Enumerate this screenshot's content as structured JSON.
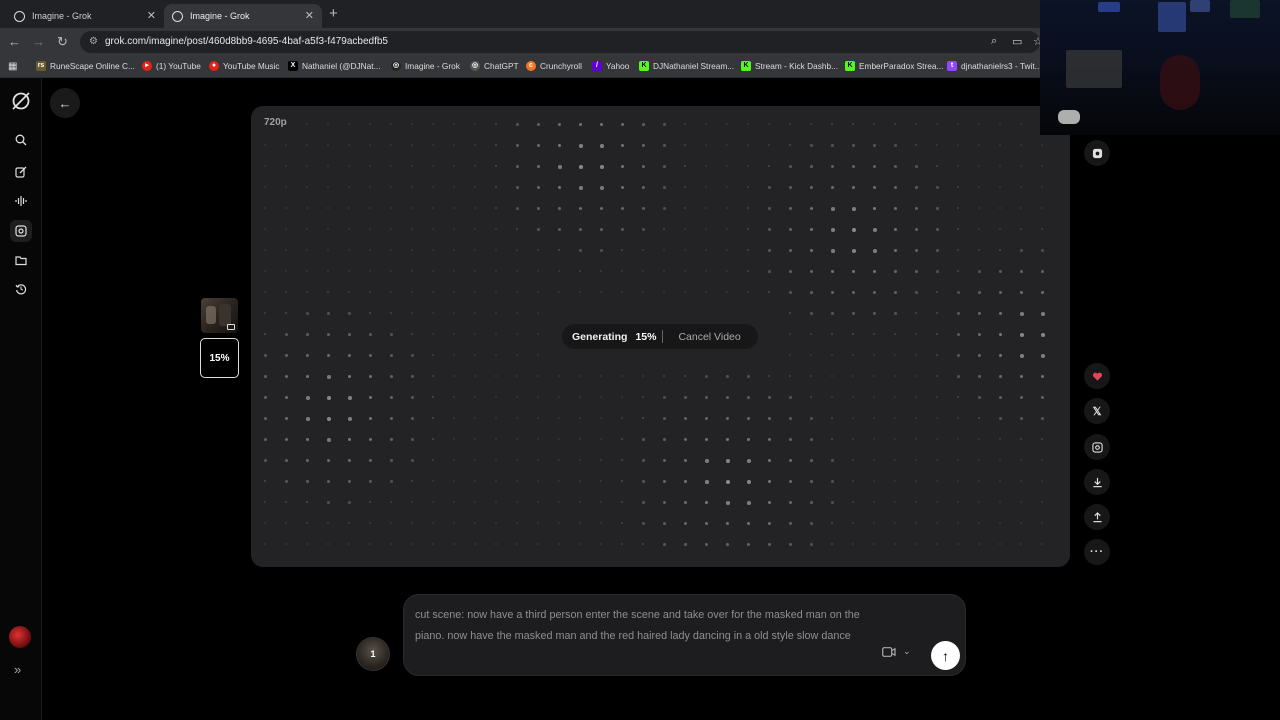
{
  "browser": {
    "tabs": [
      {
        "title": "Imagine - Grok",
        "active": false
      },
      {
        "title": "Imagine - Grok",
        "active": true
      }
    ],
    "new_tab_icon": "plus-icon",
    "url": "grok.com/imagine/post/460d8bb9-4695-4baf-a5f3-f479acbedfb5",
    "bookmarks": [
      {
        "label": "RuneScape Online C...",
        "icon": "rs",
        "color": "#6b5a2e"
      },
      {
        "label": "(1) YouTube",
        "icon": "▶",
        "color": "#e62117"
      },
      {
        "label": "YouTube Music",
        "icon": "●",
        "color": "#e62117"
      },
      {
        "label": "Nathaniel (@DJNat...",
        "icon": "X",
        "color": "#000000"
      },
      {
        "label": "Imagine - Grok",
        "icon": "◎",
        "color": "#222222"
      },
      {
        "label": "ChatGPT",
        "icon": "◎",
        "color": "#555555"
      },
      {
        "label": "Crunchyroll",
        "icon": "c",
        "color": "#f47521"
      },
      {
        "label": "Yahoo",
        "icon": "/",
        "color": "#6001d2"
      },
      {
        "label": "DJNathaniel Stream...",
        "icon": "K",
        "color": "#53fc18"
      },
      {
        "label": "Stream - Kick Dashb...",
        "icon": "K",
        "color": "#53fc18"
      },
      {
        "label": "EmberParadox Strea...",
        "icon": "K",
        "color": "#53fc18"
      },
      {
        "label": "djnathanielrs3 - Twit...",
        "icon": "t",
        "color": "#9146ff"
      }
    ]
  },
  "viewer": {
    "resolution": "720p",
    "progress_text": "15%",
    "generating_label": "Generating",
    "cancel_label": "Cancel Video"
  },
  "prompt": {
    "text": "cut scene: now have a third person enter the scene and take over for the masked man on the piano. now have the masked man and the red haired lady dancing in a old style slow dance",
    "count_badge": "1",
    "mode_icon": "video-camera-icon"
  },
  "colors": {
    "canvas_bg": "#232325",
    "like_red": "#e0465a",
    "page_bg": "#000000"
  }
}
